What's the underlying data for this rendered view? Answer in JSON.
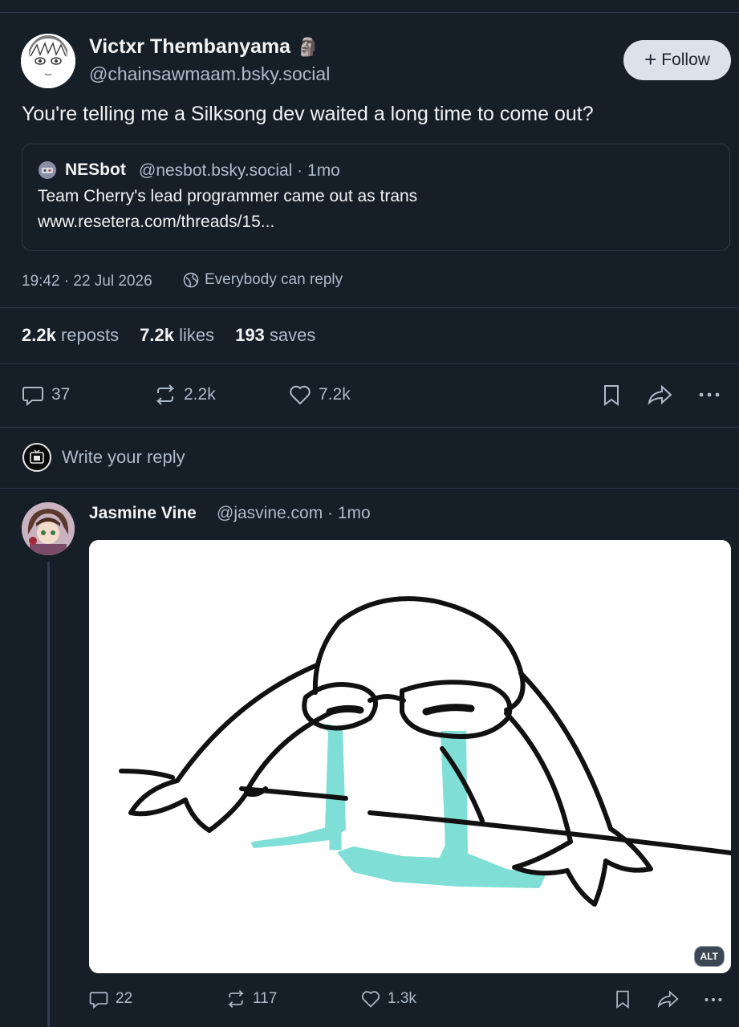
{
  "post": {
    "author_name": "Victxr Thembanyama",
    "author_emoji": "🗿",
    "author_handle": "@chainsawmaam.bsky.social",
    "follow_label": "Follow",
    "text": "You're telling me a Silksong dev waited a long time to come out?",
    "quote": {
      "name": "NESbot",
      "meta": "@nesbot.bsky.social · 1mo",
      "line1": "Team Cherry's lead programmer came out as trans",
      "line2": "www.resetera.com/threads/15..."
    },
    "timestamp": "19:42 · 22 Jul 2026",
    "reply_setting": "Everybody can reply",
    "stats": {
      "reposts_count": "2.2k",
      "reposts_label": "reposts",
      "likes_count": "7.2k",
      "likes_label": "likes",
      "saves_count": "193",
      "saves_label": "saves"
    },
    "actions": {
      "replies": "37",
      "reposts": "2.2k",
      "likes": "7.2k"
    }
  },
  "reply_box": {
    "placeholder": "Write your reply"
  },
  "reply": {
    "author_name": "Jasmine Vine",
    "meta": "@jasvine.com · 1mo",
    "alt_badge": "ALT",
    "actions": {
      "replies": "22",
      "reposts": "117",
      "likes": "1.3k"
    }
  },
  "colors": {
    "background": "#161e27",
    "divider": "#2e3c4c",
    "muted_text": "#aebbc9",
    "follow_button_bg": "#dce2ea",
    "tear_color": "#7fdfd6"
  },
  "icons": [
    "reply-icon",
    "repost-icon",
    "like-icon",
    "bookmark-icon",
    "share-icon",
    "more-icon",
    "globe-icon",
    "plus-icon"
  ]
}
